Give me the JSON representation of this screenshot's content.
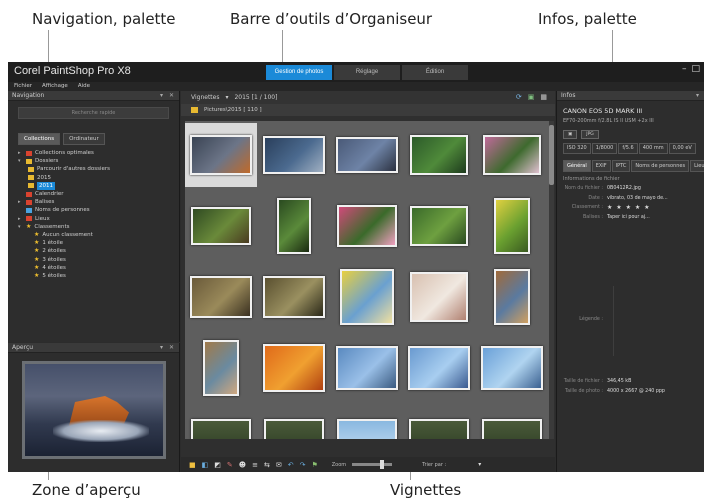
{
  "callouts": {
    "nav_palette": "Navigation, palette",
    "org_toolbar": "Barre d’outils d’Organiseur",
    "info_palette": "Infos, palette",
    "preview_zone": "Zone d’aperçu",
    "thumbnails": "Vignettes"
  },
  "app": {
    "title": "Corel PaintShop Pro X8",
    "mode_tabs": [
      "Gestion de photos",
      "Réglage",
      "Édition"
    ],
    "window_controls": [
      "–",
      "□"
    ],
    "menu": [
      "Fichier",
      "Affichage",
      "Aide"
    ]
  },
  "navigation": {
    "title": "Navigation",
    "controls": "▾ ✕",
    "search_placeholder": "Recherche rapide",
    "tabs": [
      "Collections",
      "Ordinateur"
    ],
    "tree": [
      {
        "label": "Collections optimales",
        "icon": "red"
      },
      {
        "label": "Dossiers",
        "icon": "folder"
      },
      {
        "label": "Parcourir d'autres dossiers",
        "icon": "folder"
      },
      {
        "label": "2015",
        "icon": "folder"
      },
      {
        "label": "2011",
        "icon": "folder"
      },
      {
        "label": "Calendrier",
        "icon": "red"
      },
      {
        "label": "Balises",
        "icon": "red"
      },
      {
        "label": "Noms de personnes",
        "icon": "blue"
      },
      {
        "label": "Lieux",
        "icon": "red"
      },
      {
        "label": "Classements",
        "icon": "star"
      },
      {
        "label": "Aucun classement",
        "icon": "star"
      },
      {
        "label": "1 étoile",
        "icon": "star"
      },
      {
        "label": "2 étoiles",
        "icon": "star"
      },
      {
        "label": "3 étoiles",
        "icon": "star"
      },
      {
        "label": "4 étoiles",
        "icon": "star"
      },
      {
        "label": "5 étoiles",
        "icon": "star"
      }
    ]
  },
  "preview": {
    "title": "Aperçu",
    "controls": "▾ ✕"
  },
  "organizer": {
    "view_label": "Vignettes",
    "breadcrumb": "2015  [1 / 100]",
    "path": "Pictures\\2015  [ 110 ]",
    "icons": [
      "refresh-icon",
      "image-view-icon",
      "grid-view-icon"
    ],
    "colors": {
      "accent": "#1b8ad8",
      "grid_bg": "#5e5e5e"
    },
    "bottom_icons": [
      "■",
      "◧",
      "◩",
      "✎",
      "☻",
      "≡",
      "⇆",
      "✉",
      "↶",
      "↷",
      "⚑"
    ],
    "zoom_label": "Zoom",
    "sort_label": "Trier par :",
    "thumbnails": [
      {
        "colors": [
          "#3a4454",
          "#6c7588",
          "#c06a2a"
        ],
        "w": 62,
        "h": 40,
        "selected": true
      },
      {
        "colors": [
          "#2a3f5c",
          "#4b6a8f",
          "#a0b0c2"
        ],
        "w": 62,
        "h": 38
      },
      {
        "colors": [
          "#4a5a78",
          "#6e83a6",
          "#2b3140"
        ],
        "w": 62,
        "h": 36
      },
      {
        "colors": [
          "#2c5a2a",
          "#4f8a3a",
          "#1d3a1d"
        ],
        "w": 58,
        "h": 40
      },
      {
        "colors": [
          "#c06a9a",
          "#3e6a2e",
          "#e0c0d0"
        ],
        "w": 58,
        "h": 40
      },
      {
        "colors": [
          "#2f4a22",
          "#6a8a3a",
          "#4a3a20"
        ],
        "w": 60,
        "h": 38
      },
      {
        "colors": [
          "#2a4a20",
          "#5a8a3a",
          "#1a2a10"
        ],
        "w": 34,
        "h": 56
      },
      {
        "colors": [
          "#d04a7a",
          "#3a6a2a",
          "#f0a0c0"
        ],
        "w": 60,
        "h": 42
      },
      {
        "colors": [
          "#3a6a2a",
          "#6ea040",
          "#2a4a20"
        ],
        "w": 58,
        "h": 40
      },
      {
        "colors": [
          "#e0d040",
          "#6aa030",
          "#3a5a20"
        ],
        "w": 36,
        "h": 56
      },
      {
        "colors": [
          "#6a5a3a",
          "#9a8a5a",
          "#3a3020"
        ],
        "w": 62,
        "h": 42
      },
      {
        "colors": [
          "#5a5030",
          "#9a9060",
          "#2a2818"
        ],
        "w": 62,
        "h": 42
      },
      {
        "colors": [
          "#e8d040",
          "#6aa0d0",
          "#f0e0a0"
        ],
        "w": 54,
        "h": 56
      },
      {
        "colors": [
          "#d8c0b0",
          "#f0e8e0",
          "#b08070"
        ],
        "w": 58,
        "h": 50
      },
      {
        "colors": [
          "#a06a3a",
          "#5a7aa0",
          "#d0a060"
        ],
        "w": 36,
        "h": 56
      },
      {
        "colors": [
          "#a07a4a",
          "#6a8aa0",
          "#d0a880"
        ],
        "w": 36,
        "h": 56
      },
      {
        "colors": [
          "#e06a1a",
          "#f0a030",
          "#b04010"
        ],
        "w": 62,
        "h": 48
      },
      {
        "colors": [
          "#5a8ac0",
          "#9ac0e8",
          "#3a5a80"
        ],
        "w": 62,
        "h": 44
      },
      {
        "colors": [
          "#6a9ad0",
          "#a8cef0",
          "#3a5a90"
        ],
        "w": 62,
        "h": 44
      },
      {
        "colors": [
          "#6aa0d8",
          "#b0d4f0",
          "#3a6090"
        ],
        "w": 62,
        "h": 44
      }
    ]
  },
  "info": {
    "title": "Infos",
    "controls": "▾",
    "camera": "CANON EOS 5D MARK III",
    "lens": "EF70-200mm f/2.8L IS II USM +2x III",
    "format_icon": "▣",
    "format": "JPG",
    "exif": [
      "ISO 320",
      "1/8000",
      "f/5.6",
      "400 mm",
      "0,00 eV"
    ],
    "tabs": [
      "Général",
      "EXIF",
      "IPTC",
      "Noms de personnes",
      "Lieu"
    ],
    "section": "Informations de fichier",
    "fields": [
      {
        "k": "Nom du fichier :",
        "v": "0B0412R2.jpg"
      },
      {
        "k": "Date :",
        "v": "vibrato, 03 de mayo de..."
      },
      {
        "k": "Classement :",
        "v": "★ ★ ★ ★ ★"
      },
      {
        "k": "Balises :",
        "v": "Taper ici pour aj..."
      }
    ],
    "legend_key": "Légende :",
    "size_fields": [
      {
        "k": "Taille de fichier :",
        "v": "346,45 kB"
      },
      {
        "k": "Taille de photo :",
        "v": "4000 x 2667 @ 240 ppp"
      }
    ]
  }
}
